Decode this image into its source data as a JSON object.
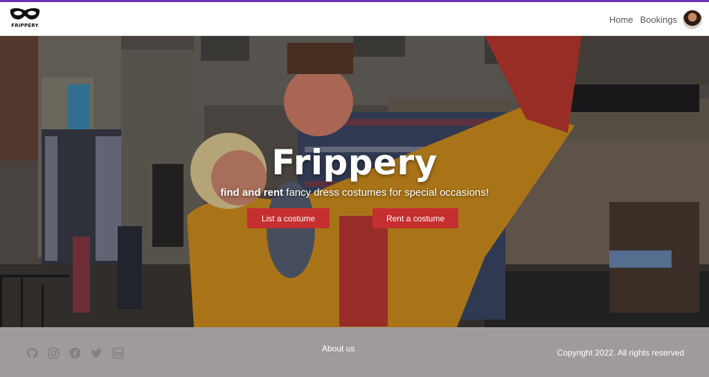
{
  "brand": {
    "name": "FRIPPERY",
    "logo_icon": "mask-icon"
  },
  "nav": {
    "home": "Home",
    "bookings": "Bookings",
    "avatar_icon": "user-avatar"
  },
  "hero": {
    "title": "Frippery",
    "subtitle_bold": "find and rent",
    "subtitle_rest": " fancy dress costumes for special occasions!",
    "button_list": "List a costume",
    "button_rent": "Rent a costume",
    "button_color": "#c62f2f"
  },
  "footer": {
    "social_icons": [
      "github-icon",
      "instagram-icon",
      "facebook-icon",
      "twitter-icon",
      "linkedin-icon"
    ],
    "about": "About us",
    "copyright": "Copyright 2022. All rights reserved",
    "background": "#a09b9b"
  },
  "colors": {
    "top_accent": "#6a2fb8"
  }
}
